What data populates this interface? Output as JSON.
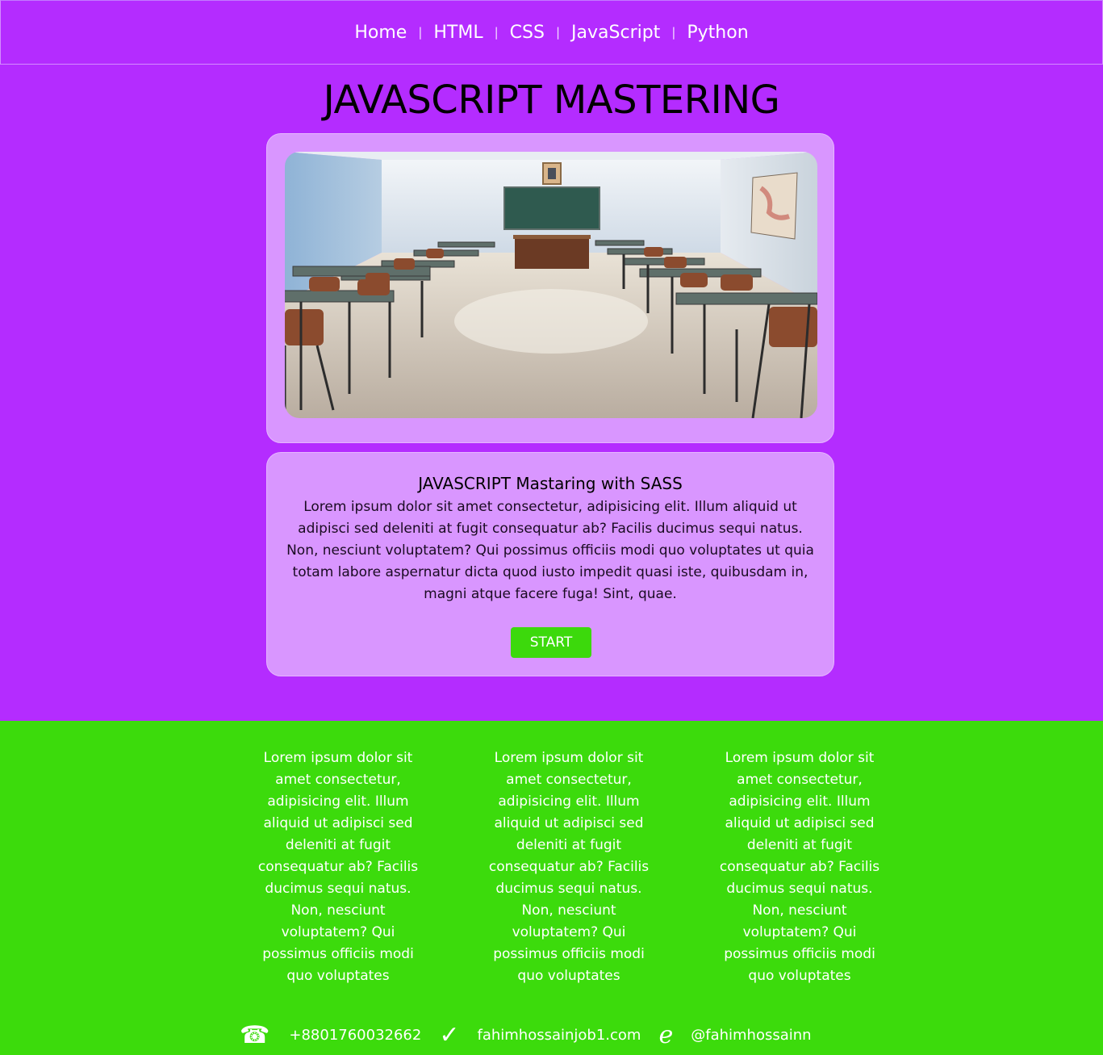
{
  "nav": {
    "items": [
      "Home",
      "HTML",
      "CSS",
      "JavaScript",
      "Python"
    ],
    "separator": "|"
  },
  "page": {
    "title": "JAVASCRIPT MASTERING"
  },
  "card": {
    "heading": "JAVASCRIPT Mastaring with SASS",
    "body": "Lorem ipsum dolor sit amet consectetur, adipisicing elit. Illum aliquid ut adipisci sed deleniti at fugit consequatur ab? Facilis ducimus sequi natus. Non, nesciunt voluptatem? Qui possimus officiis modi quo voluptates ut quia totam labore aspernatur dicta quod iusto impedit quasi iste, quibusdam in, magni atque facere fuga! Sint, quae.",
    "button": "START"
  },
  "footer": {
    "columns": [
      "Lorem ipsum dolor sit amet consectetur, adipisicing elit. Illum aliquid ut adipisci sed deleniti at fugit consequatur ab? Facilis ducimus sequi natus. Non, nesciunt voluptatem? Qui possimus officiis modi quo voluptates",
      "Lorem ipsum dolor sit amet consectetur, adipisicing elit. Illum aliquid ut adipisci sed deleniti at fugit consequatur ab? Facilis ducimus sequi natus. Non, nesciunt voluptatem? Qui possimus officiis modi quo voluptates",
      "Lorem ipsum dolor sit amet consectetur, adipisicing elit. Illum aliquid ut adipisci sed deleniti at fugit consequatur ab? Facilis ducimus sequi natus. Non, nesciunt voluptatem? Qui possimus officiis modi quo voluptates"
    ],
    "contact": {
      "phone": "+8801760032662",
      "email": "fahimhossainjob1.com",
      "handle": "@fahimhossainn",
      "icons": {
        "phone": "☎",
        "email": "✓",
        "handle": "ℯ"
      }
    }
  },
  "colors": {
    "background": "#b42cff",
    "card": "#d996ff",
    "accent_green": "#3cdb0c",
    "text_light": "#ffffff"
  }
}
